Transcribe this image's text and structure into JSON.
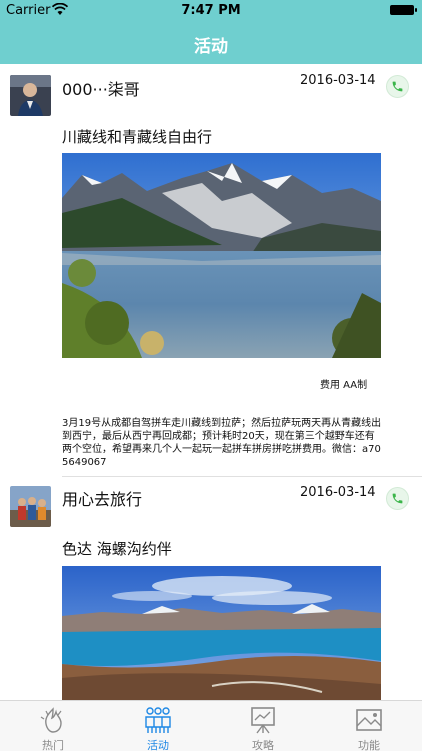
{
  "status": {
    "carrier": "Carrier",
    "time": "7:47 PM"
  },
  "nav": {
    "title": "活动"
  },
  "posts": [
    {
      "user": "000···柒哥",
      "date": "2016-03-14",
      "title": "川藏线和青藏线自由行",
      "fee": "费用 AA制",
      "desc": "3月19号从成都自驾拼车走川藏线到拉萨；然后拉萨玩两天再从青藏线出到西宁，最后从西宁再回成都；预计耗时20天，现在第三个越野车还有两个空位，希望再来几个人一起玩一起拼车拼房拼吃拼费用。微信：a705649067"
    },
    {
      "user": "用心去旅行",
      "date": "2016-03-14",
      "title": "色达 海螺沟约伴"
    }
  ],
  "tabs": [
    {
      "label": "热门",
      "icon": "hot-icon"
    },
    {
      "label": "活动",
      "icon": "activity-icon"
    },
    {
      "label": "攻略",
      "icon": "guide-icon"
    },
    {
      "label": "功能",
      "icon": "function-icon"
    }
  ],
  "colors": {
    "nav": "#6fcfcf",
    "tab_active": "#1e88e5",
    "phone": "#3bb54a"
  }
}
